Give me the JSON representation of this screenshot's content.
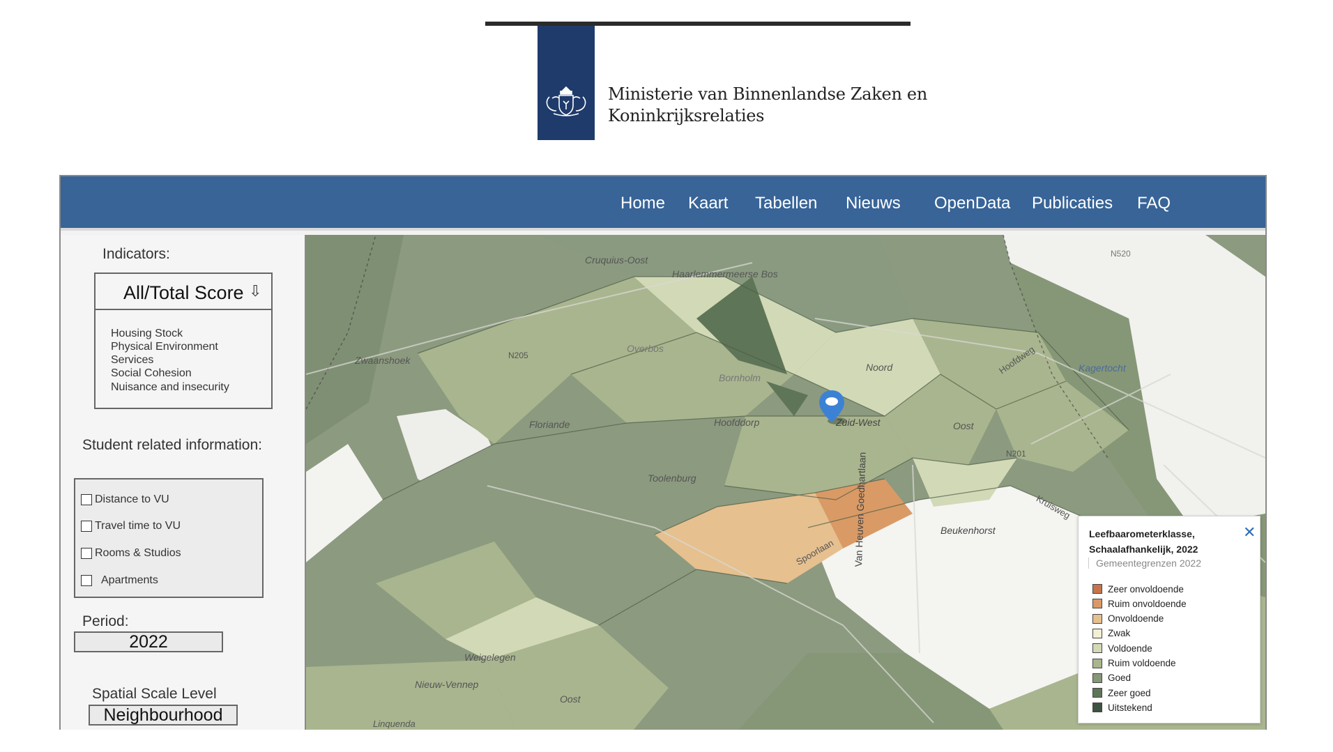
{
  "header": {
    "ministry_line1": "Ministerie van Binnenlandse Zaken en",
    "ministry_line2": "Koninkrijksrelaties",
    "logo_icon": "coat-of-arms-icon"
  },
  "nav": {
    "items": [
      {
        "label": "Home"
      },
      {
        "label": "Kaart"
      },
      {
        "label": "Tabellen"
      },
      {
        "label": "Nieuws"
      },
      {
        "label": "OpenData"
      },
      {
        "label": "Publicaties"
      },
      {
        "label": "FAQ"
      }
    ],
    "background": "#386497"
  },
  "sidebar": {
    "indicators_label": "Indicators:",
    "indicator_selected": "All/Total Score",
    "indicator_arrow": "⇩",
    "indicator_options": [
      "Housing Stock",
      "Physical Environment",
      "Services",
      "Social Cohesion",
      "Nuisance and insecurity"
    ],
    "student_label": "Student related information:",
    "student_options": [
      {
        "label": "Distance to VU",
        "checked": false
      },
      {
        "label": "Travel time to VU",
        "checked": false
      },
      {
        "label": "Rooms & Studios",
        "checked": false
      },
      {
        "label": "Apartments",
        "checked": false
      }
    ],
    "period_label": "Period:",
    "period_value": "2022",
    "scale_label": "Spatial Scale Level",
    "scale_value": "Neighbourhood"
  },
  "map": {
    "place_labels": [
      "Cruquius-Oost",
      "Haarlemmermeerse Bos",
      "Overbos",
      "Bornholm",
      "Noord",
      "Zwaanshoek",
      "Floriande",
      "Hoofddorp",
      "Zuid-West",
      "Oost",
      "Toolenburg",
      "Kagertocht",
      "Beukenhorst",
      "Weigelegen",
      "Nieuw-Vennep",
      "Oost",
      "Linquenda"
    ],
    "road_labels": [
      "N205",
      "N201",
      "N520",
      "Van Heuven Goedhartlaan",
      "Kruisweg",
      "Hoofdweg",
      "Spoorlaan"
    ],
    "marker_icon": "map-pin-icon"
  },
  "legend": {
    "title": "Leefbaarometerklasse, Schaalafhankelijk, 2022",
    "subtitle": "Gemeentegrenzen 2022",
    "close_icon": "close-icon",
    "classes": [
      {
        "label": "Zeer onvoldoende",
        "color": "#c8744a"
      },
      {
        "label": "Ruim onvoldoende",
        "color": "#d99a66"
      },
      {
        "label": "Onvoldoende",
        "color": "#e6c08f"
      },
      {
        "label": "Zwak",
        "color": "#f4efd2"
      },
      {
        "label": "Voldoende",
        "color": "#d2d9b7"
      },
      {
        "label": "Ruim voldoende",
        "color": "#a9b58e"
      },
      {
        "label": "Goed",
        "color": "#869777"
      },
      {
        "label": "Zeer goed",
        "color": "#5f7558"
      },
      {
        "label": "Uitstekend",
        "color": "#3d5240"
      }
    ]
  }
}
